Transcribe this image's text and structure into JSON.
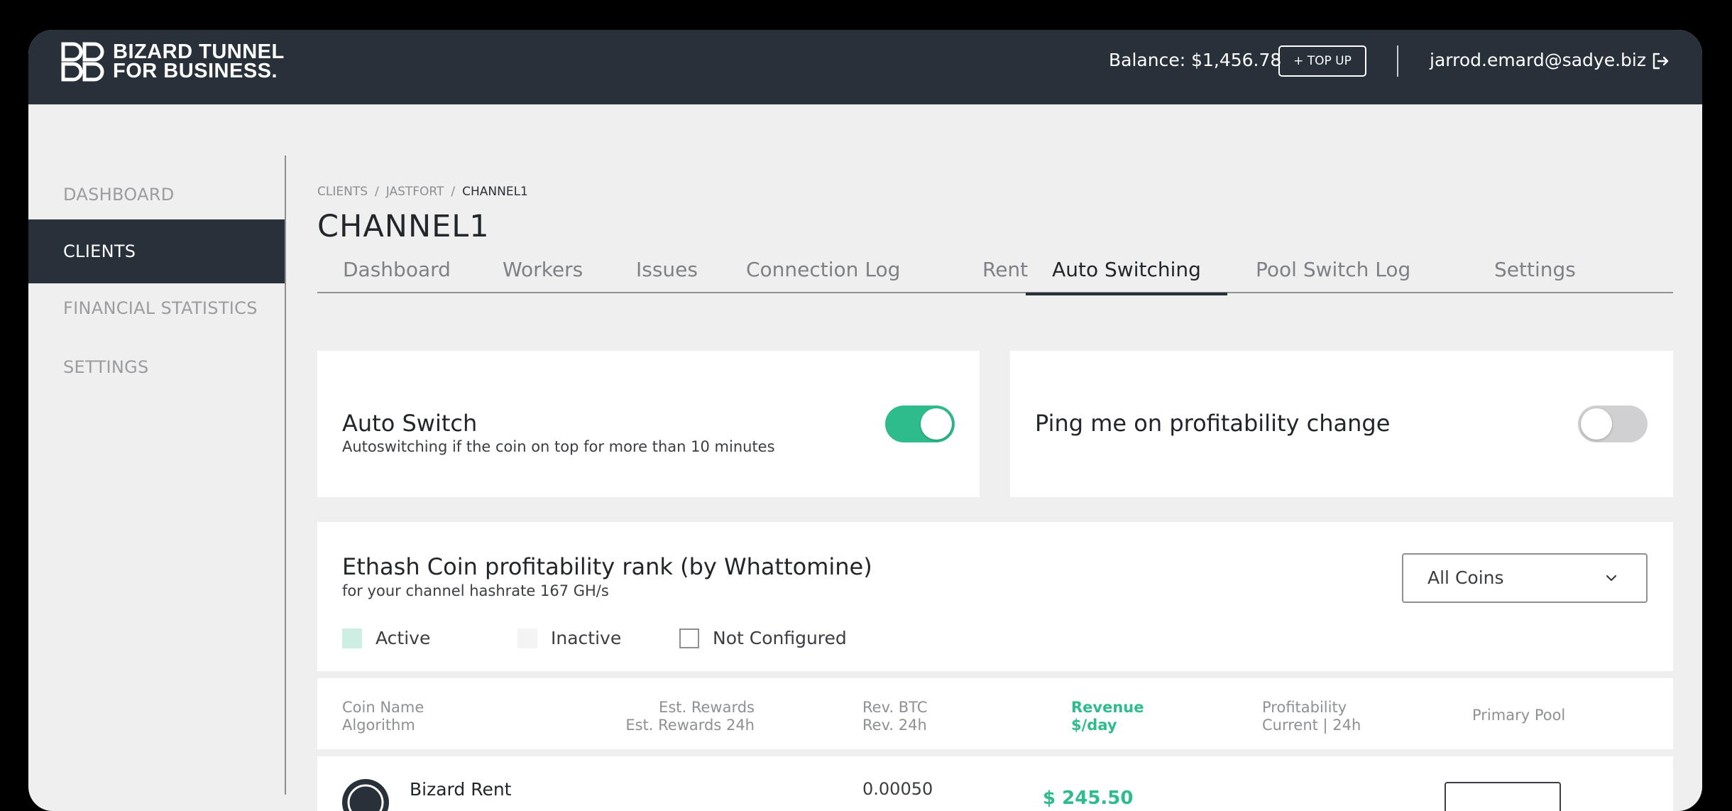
{
  "header": {
    "logo_line1": "BIZARD TUNNEL",
    "logo_line2": "FOR BUSINESS.",
    "balance": "Balance: $1,456.78",
    "topup_label": "+ TOP UP",
    "email": "jarrod.emard@sadye.biz",
    "logout_icon": "logout-icon"
  },
  "sidebar": {
    "items": [
      {
        "label": "DASHBOARD",
        "active": false
      },
      {
        "label": "CLIENTS",
        "active": true
      },
      {
        "label": "FINANCIAL STATISTICS",
        "active": false
      },
      {
        "label": "SETTINGS",
        "active": false
      }
    ]
  },
  "breadcrumb": {
    "items": [
      "CLIENTS",
      "JASTFORT",
      "CHANNEL1"
    ],
    "separator": "/"
  },
  "page": {
    "title": "CHANNEL1"
  },
  "tabs": [
    {
      "label": "Dashboard",
      "active": false
    },
    {
      "label": "Workers",
      "active": false
    },
    {
      "label": "Issues",
      "active": false
    },
    {
      "label": "Connection Log",
      "active": false
    },
    {
      "label": "Rent",
      "active": false
    },
    {
      "label": "Auto Switching",
      "active": true
    },
    {
      "label": "Pool Switch Log",
      "active": false
    },
    {
      "label": "Settings",
      "active": false
    }
  ],
  "auto_switch": {
    "title": "Auto Switch",
    "subtitle": "Autoswitching if the coin on top for more than 10 minutes",
    "enabled": true
  },
  "ping": {
    "title": "Ping me on profitability change",
    "enabled": false
  },
  "rank": {
    "title": "Ethash Coin profitability rank (by Whattomine)",
    "subtitle": "for your channel hashrate 167 GH/s",
    "filter_selected": "All Coins",
    "legend": [
      {
        "label": "Active",
        "kind": "active"
      },
      {
        "label": "Inactive",
        "kind": "inactive"
      },
      {
        "label": "Not Configured",
        "kind": "notconf"
      }
    ]
  },
  "table": {
    "headers": {
      "coin_name": "Coin Name",
      "algorithm": "Algorithm",
      "est_rewards": "Est. Rewards",
      "est_rewards_24h": "Est. Rewards 24h",
      "rev_btc": "Rev. BTC",
      "rev_24h": "Rev. 24h",
      "revenue": "Revenue",
      "per_day": "$/day",
      "profitability": "Profitability",
      "current_24h": "Current | 24h",
      "primary_pool": "Primary Pool"
    },
    "rows": [
      {
        "name": "Bizard Rent",
        "rev_btc": "0.00050",
        "revenue": "$ 245.50"
      }
    ]
  },
  "colors": {
    "topbar": "#283039",
    "accent_green": "#2ebc8c",
    "active_swatch": "#cdeee2",
    "page_bg": "#efeff0"
  }
}
